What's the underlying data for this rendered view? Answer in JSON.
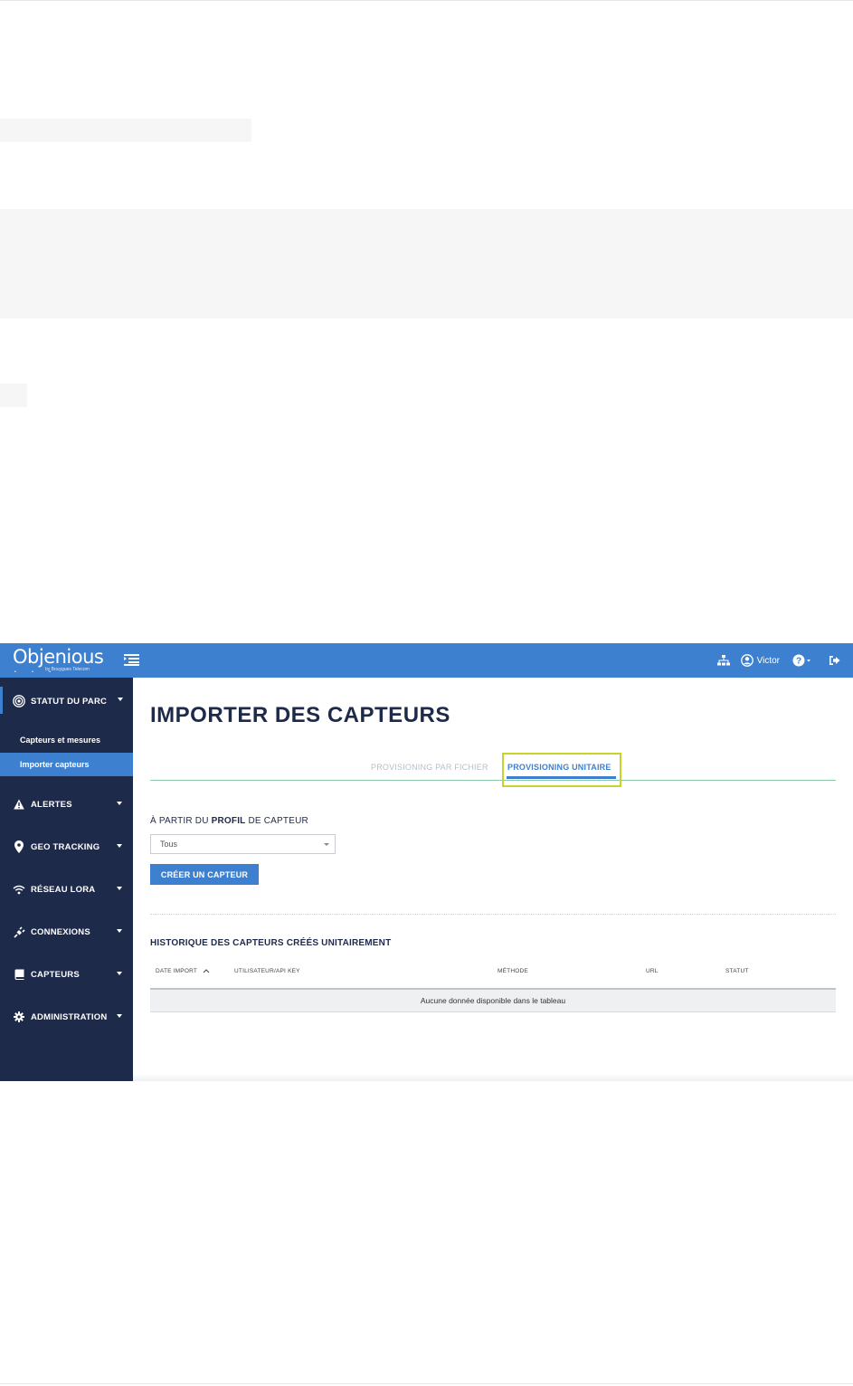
{
  "app": {
    "logo": {
      "name": "Objenious",
      "tagline": "by Bouygues Telecom"
    },
    "topbar": {
      "user_name": "Victor"
    },
    "sidebar": {
      "items": [
        {
          "label": "STATUT DU PARC",
          "icon": "target-icon"
        },
        {
          "label": "ALERTES",
          "icon": "warning-icon"
        },
        {
          "label": "GEO TRACKING",
          "icon": "location-pin-icon"
        },
        {
          "label": "RÉSEAU LORA",
          "icon": "wifi-icon"
        },
        {
          "label": "CONNEXIONS",
          "icon": "plug-icon"
        },
        {
          "label": "CAPTEURS",
          "icon": "book-icon"
        },
        {
          "label": "ADMINISTRATION",
          "icon": "gear-icon"
        }
      ],
      "subitems": [
        {
          "label": "Capteurs et mesures"
        },
        {
          "label": "Importer capteurs"
        }
      ]
    },
    "main": {
      "title": "IMPORTER DES CAPTEURS",
      "tabs": [
        {
          "label": "PROVISIONING PAR FICHIER"
        },
        {
          "label": "PROVISIONING UNITAIRE"
        }
      ],
      "profile_label_prefix": "À PARTIR DU ",
      "profile_label_bold": "PROFIL",
      "profile_label_suffix": " DE CAPTEUR",
      "profile_select_value": "Tous",
      "create_button": "CRÉER UN CAPTEUR",
      "history_title": "HISTORIQUE DES CAPTEURS CRÉÉS UNITAIREMENT",
      "table": {
        "columns": [
          "DATE IMPORT",
          "UTILISATEUR/API KEY",
          "MÉTHODE",
          "URL",
          "STATUT"
        ],
        "empty_message": "Aucune donnée disponible dans le tableau"
      }
    },
    "colors": {
      "primary": "#3e80d0",
      "sidebar": "#1e2a4a",
      "highlight": "#c8d42a"
    }
  }
}
